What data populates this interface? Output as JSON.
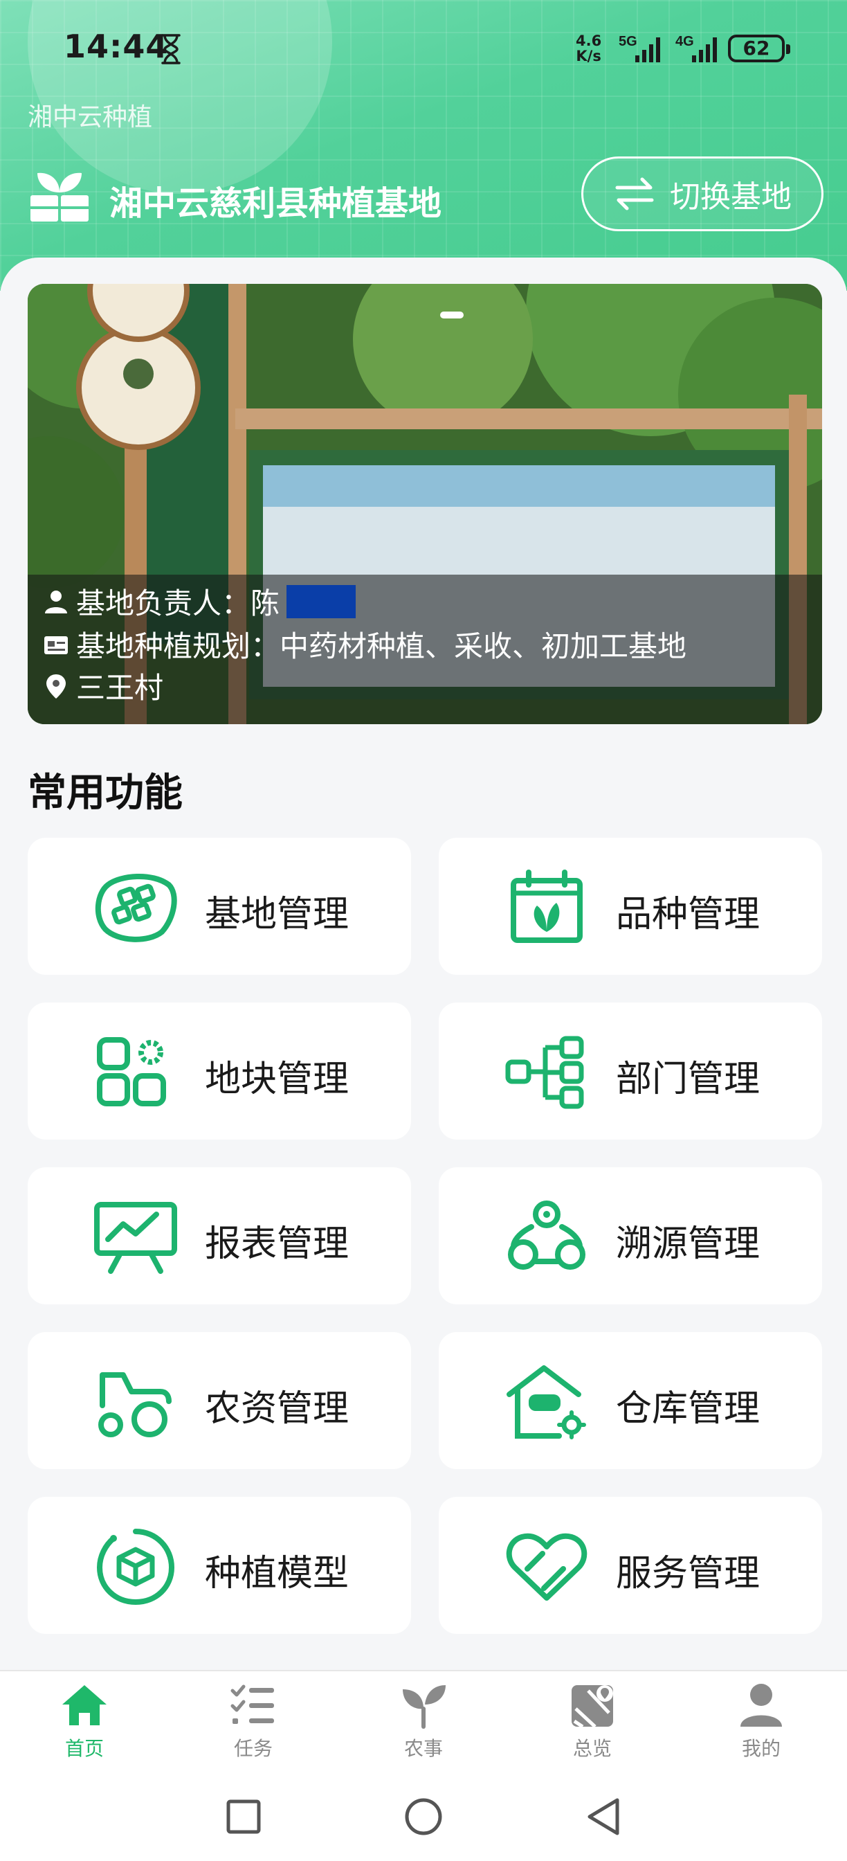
{
  "status_bar": {
    "time": "14:44",
    "net_speed_value": "4.6",
    "net_speed_unit": "K/s",
    "signal_1": "5G",
    "signal_2": "4G",
    "battery": "62"
  },
  "app": {
    "title": "湘中云种植",
    "base_name": "湘中云慈利县种植基地",
    "switch_button": "切换基地"
  },
  "banner": {
    "manager_label": "基地负责人：陈",
    "plan_label": "基地种植规划：中药材种植、采收、初加工基地",
    "location": "三王村"
  },
  "section": {
    "title": "常用功能"
  },
  "features": [
    {
      "label": "基地管理",
      "icon": "base-management-icon"
    },
    {
      "label": "品种管理",
      "icon": "variety-management-icon"
    },
    {
      "label": "地块管理",
      "icon": "plot-management-icon"
    },
    {
      "label": "部门管理",
      "icon": "department-management-icon"
    },
    {
      "label": "报表管理",
      "icon": "report-management-icon"
    },
    {
      "label": "溯源管理",
      "icon": "traceability-management-icon"
    },
    {
      "label": "农资管理",
      "icon": "agri-supplies-icon"
    },
    {
      "label": "仓库管理",
      "icon": "warehouse-management-icon"
    },
    {
      "label": "种植模型",
      "icon": "planting-model-icon"
    },
    {
      "label": "服务管理",
      "icon": "service-management-icon"
    }
  ],
  "bottom_nav": [
    {
      "label": "首页",
      "icon": "home-icon",
      "active": true
    },
    {
      "label": "任务",
      "icon": "task-list-icon",
      "active": false
    },
    {
      "label": "农事",
      "icon": "sprout-icon",
      "active": false
    },
    {
      "label": "总览",
      "icon": "map-overview-icon",
      "active": false
    },
    {
      "label": "我的",
      "icon": "profile-icon",
      "active": false
    }
  ],
  "colors": {
    "accent": "#1fb86a",
    "icon_green": "#1db36e",
    "header": "#52d19a",
    "nav_inactive": "#8a8a8a"
  }
}
